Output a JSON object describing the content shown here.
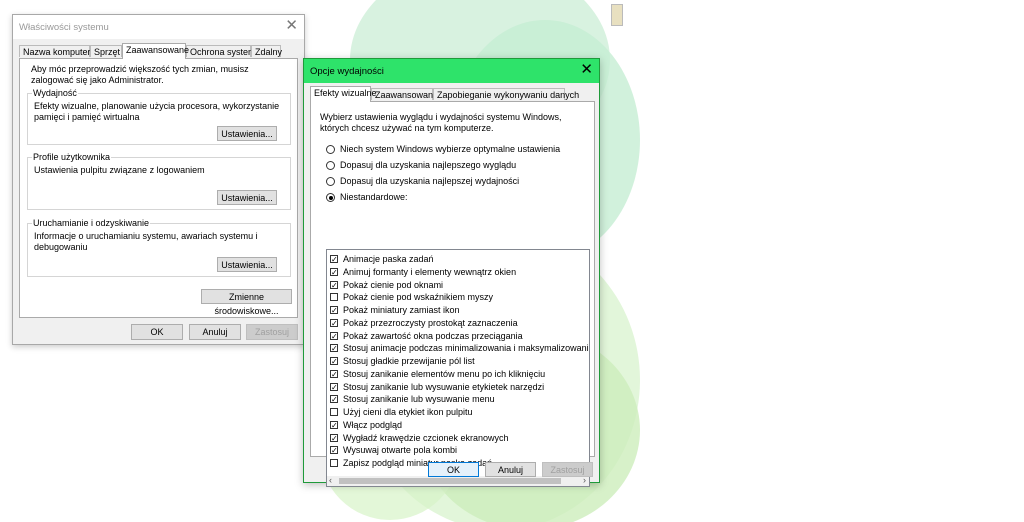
{
  "system_properties": {
    "title": "Właściwości systemu",
    "tabs": [
      "Nazwa komputera",
      "Sprzęt",
      "Zaawansowane",
      "Ochrona systemu",
      "Zdalny"
    ],
    "active_tab": 2,
    "admin_note": "Aby móc przeprowadzić większość tych zmian, musisz zalogować się jako Administrator.",
    "performance": {
      "legend": "Wydajność",
      "description": "Efekty wizualne, planowanie użycia procesora, wykorzystanie pamięci i pamięć wirtualna",
      "button": "Ustawienia..."
    },
    "user_profiles": {
      "legend": "Profile użytkownika",
      "description": "Ustawienia pulpitu związane z logowaniem",
      "button": "Ustawienia..."
    },
    "startup_recovery": {
      "legend": "Uruchamianie i odzyskiwanie",
      "description": "Informacje o uruchamianiu systemu, awariach systemu i debugowaniu",
      "button": "Ustawienia..."
    },
    "env_button": "Zmienne środowiskowe...",
    "ok": "OK",
    "cancel": "Anuluj",
    "apply": "Zastosuj"
  },
  "performance_options": {
    "title": "Opcje wydajności",
    "tabs": [
      "Efekty wizualne",
      "Zaawansowane",
      "Zapobieganie wykonywaniu danych"
    ],
    "active_tab": 0,
    "intro": "Wybierz ustawienia wyglądu i wydajności systemu Windows, których chcesz używać na tym komputerze.",
    "radios": [
      {
        "label": "Niech system Windows wybierze optymalne ustawienia",
        "selected": false
      },
      {
        "label": "Dopasuj dla uzyskania najlepszego wyglądu",
        "selected": false
      },
      {
        "label": "Dopasuj dla uzyskania najlepszej wydajności",
        "selected": false
      },
      {
        "label": "Niestandardowe:",
        "selected": true
      }
    ],
    "effects": [
      {
        "label": "Animacje paska zadań",
        "checked": true
      },
      {
        "label": "Animuj formanty i elementy wewnątrz okien",
        "checked": true
      },
      {
        "label": "Pokaż cienie pod oknami",
        "checked": true
      },
      {
        "label": "Pokaż cienie pod wskaźnikiem myszy",
        "checked": false
      },
      {
        "label": "Pokaż miniatury zamiast ikon",
        "checked": true
      },
      {
        "label": "Pokaż przezroczysty prostokąt zaznaczenia",
        "checked": true
      },
      {
        "label": "Pokaż zawartość okna podczas przeciągania",
        "checked": true
      },
      {
        "label": "Stosuj animacje podczas minimalizowania i maksymalizowania ok",
        "checked": true
      },
      {
        "label": "Stosuj gładkie przewijanie pól list",
        "checked": true
      },
      {
        "label": "Stosuj zanikanie elementów menu po ich kliknięciu",
        "checked": true
      },
      {
        "label": "Stosuj zanikanie lub wysuwanie etykietek narzędzi",
        "checked": true
      },
      {
        "label": "Stosuj zanikanie lub wysuwanie menu",
        "checked": true
      },
      {
        "label": "Użyj cieni dla etykiet ikon pulpitu",
        "checked": false
      },
      {
        "label": "Włącz podgląd",
        "checked": true
      },
      {
        "label": "Wygładź krawędzie czcionek ekranowych",
        "checked": true
      },
      {
        "label": "Wysuwaj otwarte pola kombi",
        "checked": true
      },
      {
        "label": "Zapisz podgląd miniatur paska zadań",
        "checked": false
      }
    ],
    "ok": "OK",
    "cancel": "Anuluj",
    "apply": "Zastosuj"
  },
  "colors": {
    "accent_green": "#2ee36a",
    "default_button_border": "#0078d7"
  }
}
